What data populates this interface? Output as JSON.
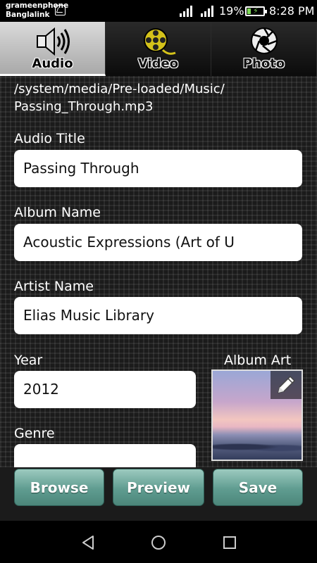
{
  "status_bar": {
    "carrier_line1": "grameenphone",
    "carrier_line2": "Banglalink",
    "battery_percent": "19%",
    "time": "8:28 PM",
    "charging": true
  },
  "tabs": [
    {
      "label": "Audio",
      "icon": "speaker-icon",
      "active": true
    },
    {
      "label": "Video",
      "icon": "film-reel-icon",
      "active": false
    },
    {
      "label": "Photo",
      "icon": "camera-aperture-icon",
      "active": false
    }
  ],
  "file_path": {
    "line1": "/system/media/Pre-loaded/Music/",
    "line2": "Passing_Through.mp3"
  },
  "fields": {
    "audio_title": {
      "label": "Audio Title",
      "value": "Passing Through"
    },
    "album_name": {
      "label": "Album Name",
      "value": "Acoustic Expressions (Art of U"
    },
    "artist_name": {
      "label": "Artist Name",
      "value": "Elias Music Library"
    },
    "year": {
      "label": "Year",
      "value": "2012"
    },
    "genre": {
      "label": "Genre",
      "value": ""
    }
  },
  "album_art": {
    "label": "Album Art",
    "edit_icon": "pencil-icon"
  },
  "buttons": {
    "browse": "Browse",
    "preview": "Preview",
    "save": "Save"
  },
  "colors": {
    "button_teal": "#5f9c90",
    "battery_green": "#7ed957"
  }
}
